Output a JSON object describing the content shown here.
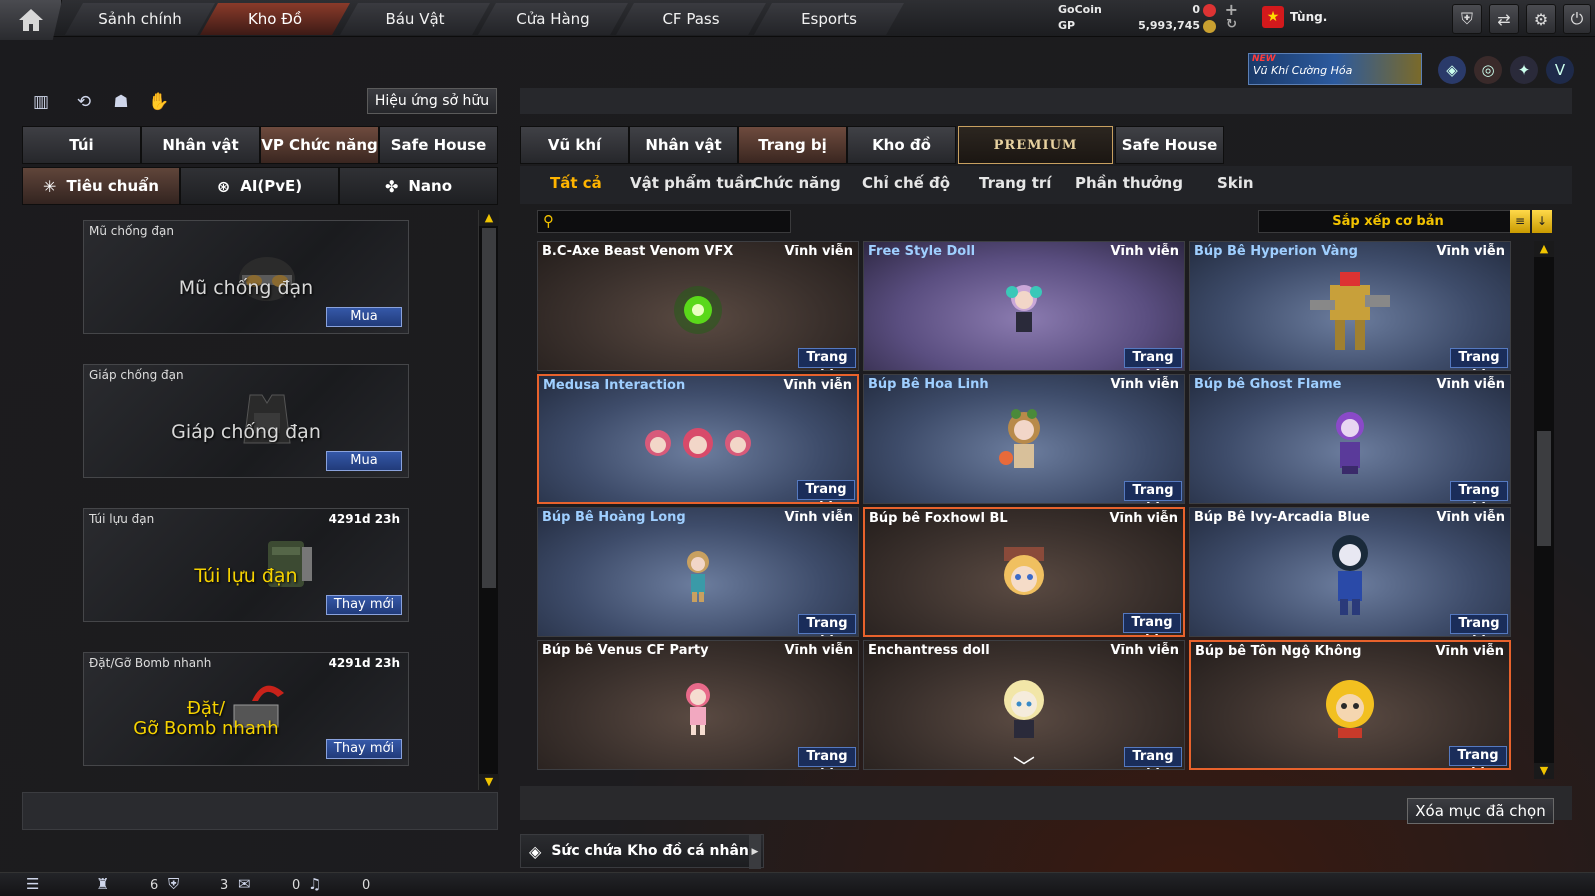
{
  "nav": {
    "tabs": [
      "Sảnh chính",
      "Kho Đồ",
      "Báu Vật",
      "Cửa Hàng",
      "CF Pass",
      "Esports"
    ],
    "active": "Kho Đồ"
  },
  "currency": {
    "gocoin_label": "GoCoin",
    "gocoin_value": "0",
    "gp_label": "GP",
    "gp_value": "5,993,745"
  },
  "user": {
    "name": "Tùng."
  },
  "promo": {
    "new_badge": "NEW",
    "text": "Vũ Khí Cường Hóa"
  },
  "left": {
    "owned_effect_button": "Hiệu ứng sở hữu",
    "tabs": [
      "Túi",
      "Nhân vật",
      "VP Chức năng",
      "Safe House"
    ],
    "active_tab": "VP Chức năng",
    "subtabs": [
      "Tiêu chuẩn",
      "AI(PvE)",
      "Nano"
    ],
    "active_subtab": "Tiêu chuẩn",
    "items": [
      {
        "name": "Mũ chống đạn",
        "big": "Mũ chống đạn",
        "time": "",
        "button": "Mua"
      },
      {
        "name": "Giáp chống đạn",
        "big": "Giáp chống đạn",
        "time": "",
        "button": "Mua"
      },
      {
        "name": "Túi lựu đạn",
        "big": "Túi lựu đạn",
        "time": "4291d 23h",
        "button": "Thay mới"
      },
      {
        "name": "Đặt/Gỡ Bomb nhanh",
        "big": "Đặt/\nGỡ Bomb nhanh",
        "time": "4291d 23h",
        "button": "Thay mới"
      }
    ]
  },
  "main": {
    "tabs": [
      "Vũ khí",
      "Nhân vật",
      "Trang bị",
      "Kho đồ",
      "PREMIUM",
      "Safe House"
    ],
    "active_tab": "Trang bị",
    "filters": [
      "Tất cả",
      "Vật phẩm tuần",
      "Chức năng",
      "Chỉ chế độ",
      "Trang trí",
      "Phần thưởng",
      "Skin"
    ],
    "active_filter": "Tất cả",
    "search_placeholder": "",
    "sort_label": "Sắp xếp cơ bản",
    "delete_button": "Xóa mục đã chọn",
    "capacity_label": "Sức chứa Kho đồ cá nhân",
    "items": [
      {
        "name": "B.C-Axe Beast Venom VFX",
        "duration": "Vĩnh viễn",
        "action": "Trang bị",
        "bg": "brown",
        "sel": false,
        "blue": false,
        "art": "green-orb"
      },
      {
        "name": "Free Style Doll",
        "duration": "Vĩnh viễn",
        "action": "Trang bị",
        "bg": "purple",
        "sel": false,
        "blue": true,
        "art": "doll-teal"
      },
      {
        "name": "Búp Bê Hyperion Vàng",
        "duration": "Vĩnh viễn",
        "action": "Trang bị",
        "bg": "blue",
        "sel": false,
        "blue": true,
        "art": "mech-gold"
      },
      {
        "name": "Medusa Interaction",
        "duration": "Vĩnh viễn",
        "action": "Trang bị",
        "bg": "blue",
        "sel": true,
        "blue": true,
        "art": "medusa"
      },
      {
        "name": "Búp Bê Hoa Linh",
        "duration": "Vĩnh viễn",
        "action": "Trang bị",
        "bg": "blue",
        "sel": false,
        "blue": true,
        "art": "doll-flower"
      },
      {
        "name": "Búp bê Ghost Flame",
        "duration": "Vĩnh viễn",
        "action": "Trang bị",
        "bg": "blue",
        "sel": false,
        "blue": true,
        "art": "doll-purple"
      },
      {
        "name": "Búp Bê Hoàng Long",
        "duration": "Vĩnh viễn",
        "action": "Trang bị",
        "bg": "blue",
        "sel": false,
        "blue": true,
        "art": "doll-dragon"
      },
      {
        "name": "Búp bê Foxhowl BL",
        "duration": "Vĩnh viễn",
        "action": "Trang bị",
        "bg": "brown",
        "sel": true,
        "blue": false,
        "art": "doll-fox"
      },
      {
        "name": "Búp Bê Ivy-Arcadia Blue",
        "duration": "Vĩnh viễn",
        "action": "Trang bị",
        "bg": "blue",
        "sel": false,
        "blue": false,
        "art": "doll-ivy"
      },
      {
        "name": "Búp bê Venus CF Party",
        "duration": "Vĩnh viễn",
        "action": "Trang bị",
        "bg": "brown",
        "sel": false,
        "blue": false,
        "art": "doll-pink"
      },
      {
        "name": "Enchantress doll",
        "duration": "Vĩnh viễn",
        "action": "Trang bị",
        "bg": "brown",
        "sel": false,
        "blue": false,
        "art": "doll-blonde"
      },
      {
        "name": "Búp bê Tôn Ngộ Không",
        "duration": "Vĩnh viễn",
        "action": "Trang bị",
        "bg": "brown",
        "sel": true,
        "blue": false,
        "art": "doll-monkey"
      }
    ]
  },
  "status": {
    "count_1": "6",
    "count_2": "3",
    "count_3": "0",
    "count_4": "0"
  },
  "colors": {
    "accent": "#f2c200",
    "selected_border": "#e8622c",
    "equip_button": "#1a2d5a"
  }
}
